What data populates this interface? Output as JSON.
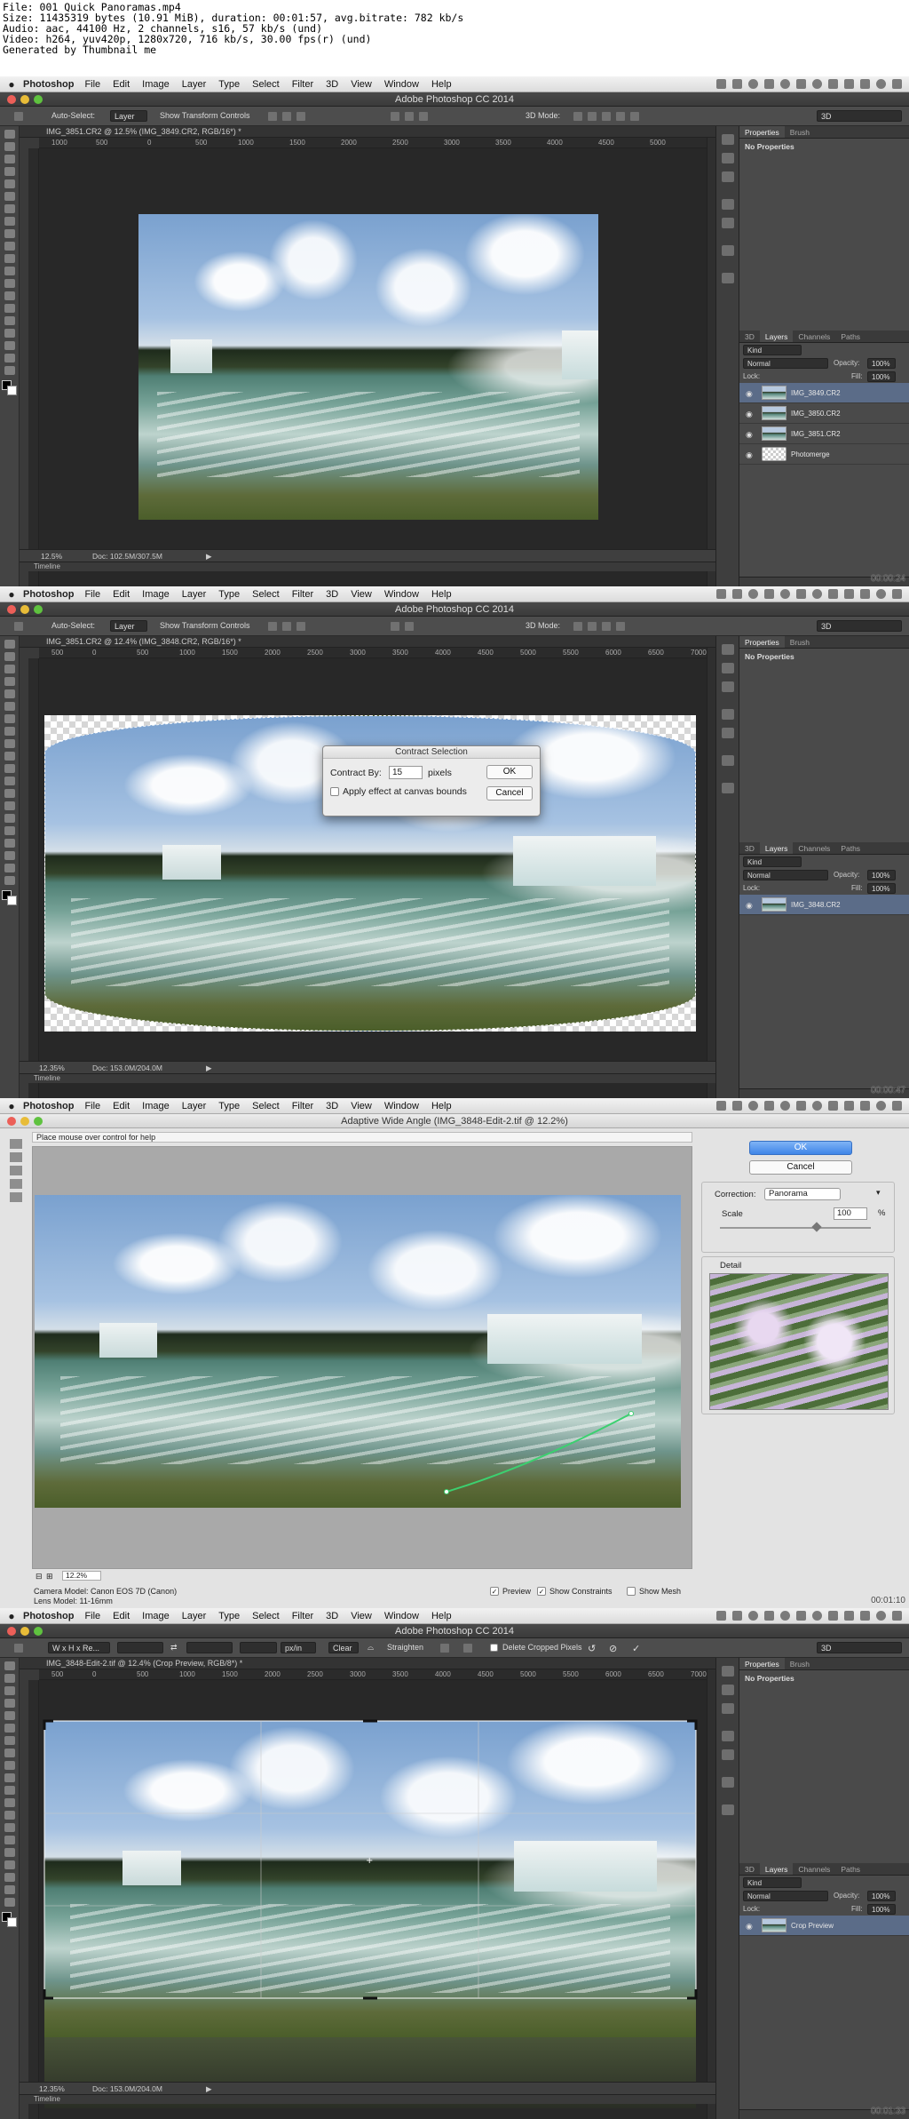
{
  "info": {
    "line1": "File: 001 Quick Panoramas.mp4",
    "line2": "Size: 11435319 bytes (10.91 MiB), duration: 00:01:57, avg.bitrate: 782 kb/s",
    "line3": "Audio: aac, 44100 Hz, 2 channels, s16, 57 kb/s (und)",
    "line4": "Video: h264, yuv420p, 1280x720, 716 kb/s, 30.00 fps(r) (und)",
    "line5": "Generated by Thumbnail me"
  },
  "menubar": {
    "app": "Photoshop",
    "items": [
      "File",
      "Edit",
      "Image",
      "Layer",
      "Type",
      "Select",
      "Filter",
      "3D",
      "View",
      "Window",
      "Help"
    ]
  },
  "window_title": "Adobe Photoshop CC 2014",
  "options": {
    "auto_select": "Auto-Select:",
    "layer_value": "Layer",
    "show_transform": "Show Transform Controls",
    "mode3d": "3D Mode:",
    "workspace": "3D"
  },
  "rulers": [
    "1000",
    "500",
    "0",
    "500",
    "1000",
    "1500",
    "2000",
    "2500",
    "3000",
    "3500",
    "4000",
    "4500",
    "5000",
    "5500",
    "6000",
    "6500",
    "7000"
  ],
  "panels": {
    "properties_tab": "Properties",
    "brush_tab": "Brush",
    "no_properties": "No Properties",
    "tab_3d": "3D",
    "tab_layers": "Layers",
    "tab_channels": "Channels",
    "tab_paths": "Paths",
    "kind": "Kind",
    "blend": "Normal",
    "opacity_label": "Opacity:",
    "opacity_value": "100%",
    "lock_label": "Lock:",
    "fill_label": "Fill:",
    "fill_value": "100%"
  },
  "frame1": {
    "doc_tab": "IMG_3851.CR2 @ 12.5% (IMG_3849.CR2, RGB/16*) *",
    "zoom": "12.5%",
    "doc": "Doc: 102.5M/307.5M",
    "timeline": "Timeline",
    "timecode": "00:00:24",
    "layers": [
      "IMG_3849.CR2",
      "IMG_3850.CR2",
      "IMG_3851.CR2",
      "Photomerge"
    ]
  },
  "frame2": {
    "doc_tab": "IMG_3851.CR2 @ 12.4% (IMG_3848.CR2, RGB/16*) *",
    "zoom": "12.35%",
    "doc": "Doc: 153.0M/204.0M",
    "timeline": "Timeline",
    "timecode": "00:00:47",
    "layers": [
      "IMG_3848.CR2"
    ],
    "dialog": {
      "title": "Contract Selection",
      "contract_label": "Contract By:",
      "contract_value": "15",
      "unit": "pixels",
      "apply_label": "Apply effect at canvas bounds",
      "ok": "OK",
      "cancel": "Cancel"
    }
  },
  "frame3": {
    "title": "Adaptive Wide Angle (IMG_3848-Edit-2.tif @ 12.2%)",
    "help": "Place mouse over control for help",
    "ok": "OK",
    "cancel": "Cancel",
    "correction_label": "Correction:",
    "correction_value": "Panorama",
    "scale_label": "Scale",
    "scale_value": "100",
    "scale_unit": "%",
    "detail_label": "Detail",
    "zoom": "12.2%",
    "camera": "Camera Model: Canon EOS 7D (Canon)",
    "lens": "Lens Model: 11-16mm",
    "preview": "Preview",
    "show_constraints": "Show Constraints",
    "show_mesh": "Show Mesh",
    "timecode": "00:01:10",
    "scale_fraction": 0.62
  },
  "frame4": {
    "ratio": "W x H x Re...",
    "resolution_unit": "px/in",
    "clear": "Clear",
    "straighten": "Straighten",
    "delete_cropped": "Delete Cropped Pixels",
    "doc_tab": "IMG_3848-Edit-2.tif @ 12.4% (Crop Preview, RGB/8*) *",
    "zoom": "12.35%",
    "doc": "Doc: 153.0M/204.0M",
    "timeline": "Timeline",
    "timecode": "00:01:33",
    "layers": [
      "Crop Preview"
    ]
  },
  "colors": {
    "traffic_red": "#ec5f58",
    "traffic_yellow": "#e8bc38",
    "traffic_green": "#5fc23f",
    "layer_selected": "#5b6c88"
  }
}
